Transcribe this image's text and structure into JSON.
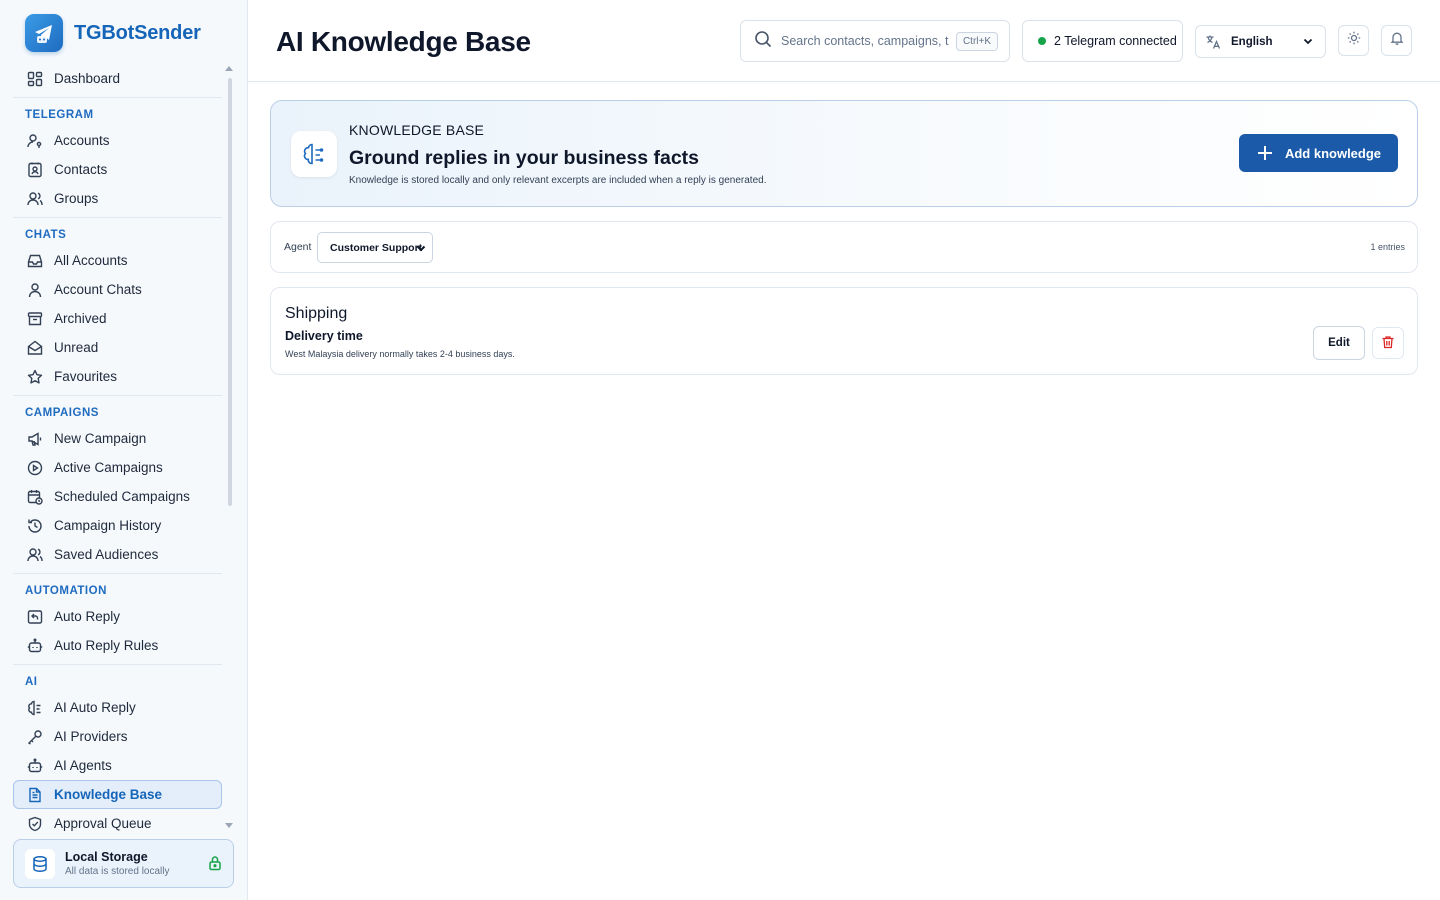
{
  "app": {
    "name": "TGBotSender"
  },
  "sidebar": {
    "dashboard": {
      "label": "Dashboard",
      "icon": "dashboard-icon"
    },
    "sections": [
      {
        "label": "TELEGRAM",
        "items": [
          {
            "label": "Accounts",
            "icon": "user-key-icon"
          },
          {
            "label": "Contacts",
            "icon": "contact-book-icon"
          },
          {
            "label": "Groups",
            "icon": "users-icon"
          }
        ]
      },
      {
        "label": "CHATS",
        "items": [
          {
            "label": "All Accounts",
            "icon": "inbox-icon"
          },
          {
            "label": "Account Chats",
            "icon": "user-icon"
          },
          {
            "label": "Archived",
            "icon": "archive-icon"
          },
          {
            "label": "Unread",
            "icon": "mail-open-icon"
          },
          {
            "label": "Favourites",
            "icon": "star-icon"
          }
        ]
      },
      {
        "label": "CAMPAIGNS",
        "items": [
          {
            "label": "New Campaign",
            "icon": "megaphone-icon"
          },
          {
            "label": "Active Campaigns",
            "icon": "play-circle-icon"
          },
          {
            "label": "Scheduled Campaigns",
            "icon": "calendar-clock-icon"
          },
          {
            "label": "Campaign History",
            "icon": "history-icon"
          },
          {
            "label": "Saved Audiences",
            "icon": "users-icon"
          }
        ]
      },
      {
        "label": "AUTOMATION",
        "items": [
          {
            "label": "Auto Reply",
            "icon": "reply-icon"
          },
          {
            "label": "Auto Reply Rules",
            "icon": "bot-icon"
          }
        ]
      },
      {
        "label": "AI",
        "items": [
          {
            "label": "AI Auto Reply",
            "icon": "brain-icon"
          },
          {
            "label": "AI Providers",
            "icon": "key-icon"
          },
          {
            "label": "AI Agents",
            "icon": "bot-icon"
          },
          {
            "label": "Knowledge Base",
            "icon": "document-icon",
            "active": true
          },
          {
            "label": "Approval Queue",
            "icon": "shield-check-icon"
          }
        ]
      }
    ],
    "storage": {
      "title": "Local Storage",
      "subtitle": "All data is stored locally"
    }
  },
  "header": {
    "title": "AI Knowledge Base",
    "search_placeholder": "Search contacts, campaigns, t...",
    "search_shortcut": "Ctrl+K",
    "connection_status": "2 Telegram connected",
    "language": "English"
  },
  "hero": {
    "eyebrow": "KNOWLEDGE BASE",
    "title": "Ground replies in your business facts",
    "description": "Knowledge is stored locally and only relevant excerpts are included when a reply is generated.",
    "add_button": "Add knowledge"
  },
  "filter": {
    "agent_label": "Agent",
    "agent_value": "Customer Support",
    "entries_count": "1 entries"
  },
  "entries": [
    {
      "category": "Shipping",
      "title": "Delivery time",
      "body": "West Malaysia delivery normally takes 2-4 business days.",
      "edit_label": "Edit"
    }
  ],
  "colors": {
    "brand": "#1565b8",
    "primary_button": "#1a5aa8",
    "status_online": "#16a34a",
    "danger": "#dc2626"
  }
}
